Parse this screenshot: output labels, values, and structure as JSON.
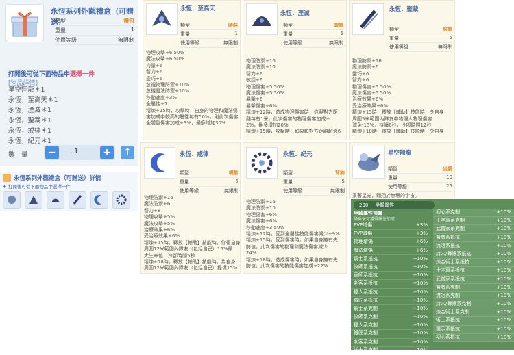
{
  "main": {
    "title": "永恆系列外觀禮盒（可贈送）",
    "rows": [
      {
        "k": "類型",
        "v": "禮包"
      },
      {
        "k": "重量",
        "v": "1"
      },
      {
        "k": "使用等級",
        "v": "無限制"
      }
    ],
    "open_prefix": "打開後可從下面物品中",
    "open_choose": "選擇一件",
    "list_header": "[物品詳情]",
    "items": [
      "星空翔龍＊1",
      "永恆，至高天＊1",
      "永恆，湮滅＊1",
      "永恆，聖裁＊1",
      "永恆，戒律＊1",
      "永恆，紀元＊1"
    ],
    "qty_label": "數　量",
    "qty_value": "1",
    "minus": "−",
    "plus": "+",
    "up": "↑"
  },
  "detail": {
    "title": "永恆系列外觀禮盒（可贈送）詳情",
    "sub": "♦ 打開後可從下面物品中選擇一件"
  },
  "cards": [
    {
      "name": "永恆．至高天",
      "rows": [
        {
          "k": "類型",
          "v": "時裝"
        },
        {
          "k": "重量",
          "v": "1"
        },
        {
          "k": "使用等級",
          "v": "無限制"
        }
      ],
      "stats": [
        "物理攻擊+6.50%",
        "魔法攻擊+6.50%",
        "力量+6",
        "智力+6",
        "靈巧+6",
        "忽視物理防禦+10%",
        "忽視魔法防禦+10%",
        "移動速度+3%",
        "全屬性+7",
        "精煉+15時，攻擊時，自身的物理和魔法傷",
        "害加成中較高的屬性每有50%，則此次傷害",
        "全體型傷害加成+3%，最多增加30%"
      ]
    },
    {
      "name": "永恆．湮滅",
      "rows": [
        {
          "k": "類型",
          "v": "頭飾"
        },
        {
          "k": "重量",
          "v": "5"
        },
        {
          "k": "使用等級",
          "v": "無限制"
        }
      ],
      "stats": [
        "物理防禦+16",
        "魔法防禦+10",
        "智力+6",
        "敏捷+6",
        "物理傷害+5.50%",
        "魔法傷害+5.50%",
        "暴擊+6",
        "暴擊傷害+6%",
        "精煉+12時，造成物理傷害時，你與對方距",
        "離每有1米，此次傷害的物理傷害加成+",
        "2%，最多增加20%",
        "精煉+15時，攻擊時，如果和對方距離超過6"
      ]
    },
    {
      "name": "永恆．聖裁",
      "rows": [
        {
          "k": "類型",
          "v": "臉飾"
        },
        {
          "k": "重量",
          "v": "5"
        },
        {
          "k": "使用等級",
          "v": "無限制"
        }
      ],
      "stats": [
        "物理防禦+16",
        "魔法防禦+6",
        "靈巧+6",
        "智力+6",
        "物理傷害+5.50%",
        "魔法傷害+5.50%",
        "治療效果+6%",
        "受治療效果+6%",
        "精煉+15時，釋放【輔助】技能時，令自身",
        "周圍5米範圍內隊友中物理人物理傷害",
        "減免-15%，持續6秒，冷卻時間12秒",
        "精煉+18時，釋放【輔助】技能時，令自身"
      ]
    },
    {
      "name": "永恆．戒律",
      "rows": [
        {
          "k": "類型",
          "v": "嘴飾"
        },
        {
          "k": "重量",
          "v": "5"
        },
        {
          "k": "使用等級",
          "v": "無限制"
        }
      ],
      "stats": [
        "物理防禦+16",
        "魔法防禦+6",
        "智力+8",
        "物理攻擊+5%",
        "魔法攻擊+5%",
        "治療效果+6%",
        "受治療效果+6%",
        "精煉+15時，釋放【輔助】技能時，你復自身",
        "周圍12米範圍內隊友（包括自己）15%最",
        "大生命值，冷卻時間5秒",
        "精煉+18時，釋放【輔助】技能時，為自身",
        "周圍12米範圍內隊友（包括自己）提供15%"
      ]
    },
    {
      "name": "永恆．紀元",
      "rows": [
        {
          "k": "類型",
          "v": "背飾"
        },
        {
          "k": "重量",
          "v": "5"
        },
        {
          "k": "使用等級",
          "v": "無限制"
        }
      ],
      "stats": [
        "物理防禦+16",
        "魔法防禦+10",
        "物理傷害+6%",
        "魔法傷害+6%",
        "移動速度+3.50%",
        "精煉+12時，受到全屬性技能傷害減少+9%",
        "精煉+15時，受到傷害時，如果自身擁有先",
        "防值，此次傷害的物理和魔法傷害減少",
        "24%",
        "精煉+18時，造成傷害時，如果自身擁有先",
        "防值，此次傷害的技能傷害加成+22%"
      ]
    },
    {
      "name": "星空翔龍",
      "rows": [
        {
          "k": "類型",
          "v": "坐騎"
        },
        {
          "k": "重量",
          "v": "10"
        },
        {
          "k": "使用等級",
          "v": "25"
        }
      ],
      "desc": "乘著星光，翱翔於無垠的宇宙。"
    }
  ],
  "attr_panel": {
    "tabs": [
      "230",
      "坐騎屬性"
    ],
    "head": "坐騎屬性預覽",
    "note": "騎乘後可獲得屬性加成",
    "left": [
      {
        "k": "PVP增傷",
        "v": "+3%"
      },
      {
        "k": "PVP減傷",
        "v": "+3%"
      },
      {
        "k": "物理增傷",
        "v": "+6%"
      },
      {
        "k": "魔法增傷",
        "v": "+6%"
      },
      {
        "k": "騎士系抵抗",
        "v": "+10%"
      },
      {
        "k": "牧師系抵抗",
        "v": "+10%"
      },
      {
        "k": "巫師系抵抗",
        "v": "+10%"
      },
      {
        "k": "刺客系抵抗",
        "v": "+10%"
      },
      {
        "k": "獵人系抵抗",
        "v": "+10%"
      },
      {
        "k": "鐵匠系抵抗",
        "v": "+10%"
      },
      {
        "k": "騎士系克制",
        "v": "+10%"
      },
      {
        "k": "牧師系克制",
        "v": "+10%"
      },
      {
        "k": "獵人系克制",
        "v": "+10%"
      },
      {
        "k": "鐵匠系克制",
        "v": "+10%"
      },
      {
        "k": "刺客系克制",
        "v": "+10%"
      },
      {
        "k": "術士系克制",
        "v": "+10%"
      }
    ],
    "right": [
      {
        "k": "初心系克制",
        "v": "+10%"
      },
      {
        "k": "十字軍系克制",
        "v": "+10%"
      },
      {
        "k": "武僧家系克制",
        "v": "+10%"
      },
      {
        "k": "賢者系抵抗",
        "v": "+10%"
      },
      {
        "k": "流氓系抵抗",
        "v": "+10%"
      },
      {
        "k": "詩人/舞孃系抵抗",
        "v": "+10%"
      },
      {
        "k": "煉金術士系抵抗",
        "v": "+10%"
      },
      {
        "k": "十字軍系抵抗",
        "v": "+10%"
      },
      {
        "k": "武僧家系抵抗",
        "v": "+10%"
      },
      {
        "k": "賢者系克制",
        "v": "+10%"
      },
      {
        "k": "流氓系克制",
        "v": "+10%"
      },
      {
        "k": "詩人/舞孃系克制",
        "v": "+10%"
      },
      {
        "k": "煉金術士系克制",
        "v": "+10%"
      },
      {
        "k": "術士系抵抗",
        "v": "+10%"
      },
      {
        "k": "獵手系抵抗",
        "v": "+10%"
      },
      {
        "k": "初心系抵抗",
        "v": "+10%"
      }
    ]
  }
}
